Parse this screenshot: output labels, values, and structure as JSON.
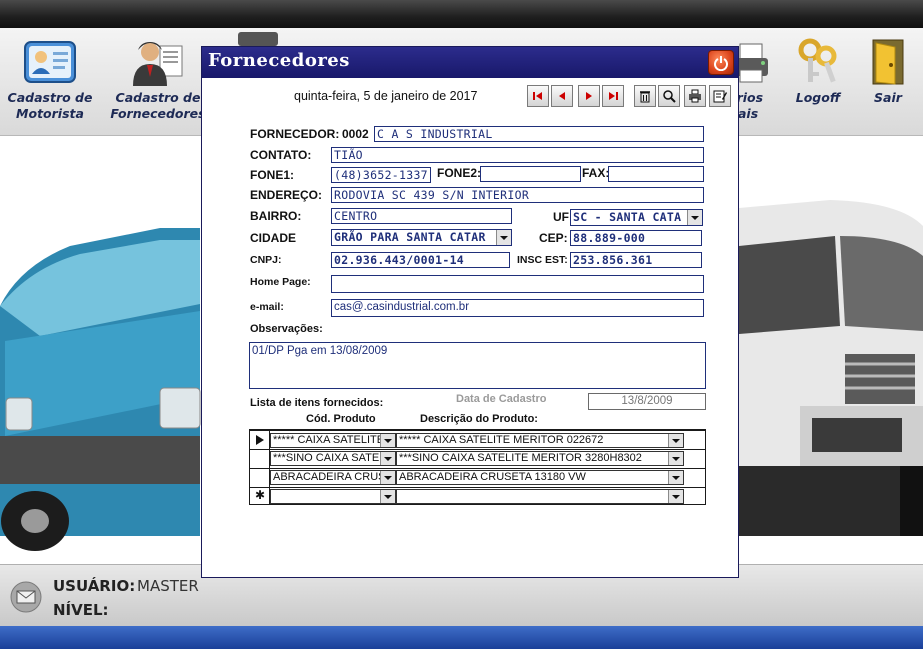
{
  "toolbar": {
    "items": [
      {
        "label_line1": "Cadastro de",
        "label_line2": "Motorista"
      },
      {
        "label_line1": "Cadastro de",
        "label_line2": "Fornecedores"
      },
      {
        "label_line1": "órios",
        "label_line2": "ais"
      },
      {
        "label": "Logoff"
      },
      {
        "label": "Sair"
      }
    ]
  },
  "status": {
    "user_label": "USUÁRIO:",
    "user_value": "MASTER",
    "level_label": "NÍVEL:"
  },
  "dialog": {
    "title": "Fornecedores",
    "date": "quinta-feira, 5 de janeiro de 2017",
    "fields": {
      "fornecedor_label": "FORNECEDOR:",
      "fornecedor_code": "0002",
      "fornecedor_name": "C A S  INDUSTRIAL",
      "contato_label": "CONTATO:",
      "contato": "TIÃO",
      "fone1_label": "FONE1:",
      "fone1": "(48)3652-1337",
      "fone2_label": "FONE2:",
      "fone2": "",
      "fax_label": "FAX:",
      "fax": "",
      "endereco_label": "ENDEREÇO:",
      "endereco": "RODOVIA SC 439  S/N INTERIOR",
      "bairro_label": "BAIRRO:",
      "bairro": "CENTRO",
      "uf_label": "UF",
      "uf": "SC  -  SANTA CATA",
      "cidade_label": "CIDADE",
      "cidade": "GRÃO PARA SANTA CATAR",
      "cep_label": "CEP:",
      "cep": "88.889-000",
      "cnpj_label": "CNPJ:",
      "cnpj": "02.936.443/0001-14",
      "insc_label": "INSC EST:",
      "insc": "253.856.361",
      "homepage_label": "Home Page:",
      "homepage": "",
      "email_label": "e-mail:",
      "email": "cas@.casindustrial.com.br",
      "obs_label": "Observações:",
      "obs": "01/DP Pga em 13/08/2009"
    },
    "items_section": {
      "title": "Lista de itens fornecidos:",
      "cadastro_label": "Data de Cadastro",
      "cadastro_value": "13/8/2009",
      "col_code": "Cód. Produto",
      "col_desc": "Descrição do Produto:",
      "rows": [
        {
          "code": "***** CAIXA SATELITE",
          "desc": "***** CAIXA SATELITE MERITOR 022672"
        },
        {
          "code": "***SINO CAIXA SATELI",
          "desc": "***SINO CAIXA SATELITE MERITOR 3280H8302"
        },
        {
          "code": "ABRACADEIRA CRUSE",
          "desc": "ABRACADEIRA CRUSETA 13180 VW"
        },
        {
          "code": "",
          "desc": ""
        }
      ]
    }
  },
  "colors": {
    "title_bar": "#18186a",
    "field_border": "#1f2f7a",
    "field_text": "#1f2f7a",
    "bottom_bar": "#1a3f98"
  }
}
